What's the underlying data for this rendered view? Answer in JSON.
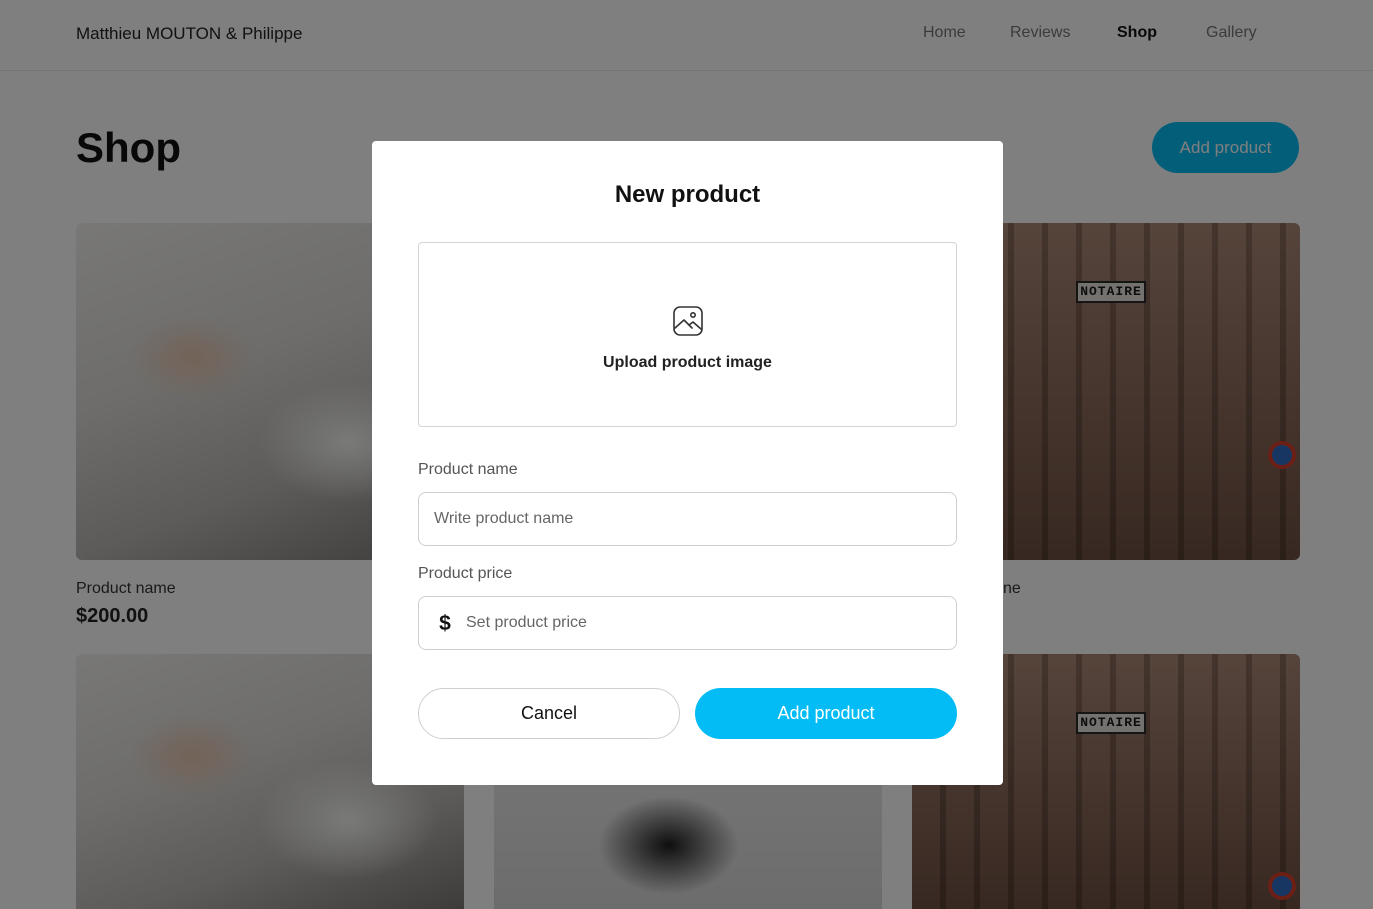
{
  "header": {
    "brand": "Matthieu MOUTON & Philippe",
    "nav": [
      {
        "label": "Home",
        "active": false
      },
      {
        "label": "Reviews",
        "active": false
      },
      {
        "label": "Shop",
        "active": true
      },
      {
        "label": "Gallery",
        "active": false
      }
    ]
  },
  "page": {
    "title": "Shop",
    "add_button": "Add product",
    "cards": [
      {
        "name": "Product name",
        "price": "$200.00",
        "image": "writing"
      },
      {
        "name": "",
        "price": "",
        "image": "stamp"
      },
      {
        "name": "ne",
        "price": "",
        "image": "building",
        "sign_text": "NOTAIRE"
      }
    ]
  },
  "modal": {
    "title": "New product",
    "upload_label": "Upload product image",
    "upload_icon": "image-icon",
    "name_label": "Product name",
    "name_placeholder": "Write product name",
    "price_label": "Product price",
    "price_placeholder": "Set product price",
    "currency_symbol": "$",
    "cancel_label": "Cancel",
    "submit_label": "Add product"
  },
  "colors": {
    "accent": "#03bcf5",
    "overlay": "rgba(0,0,0,0.50)"
  }
}
